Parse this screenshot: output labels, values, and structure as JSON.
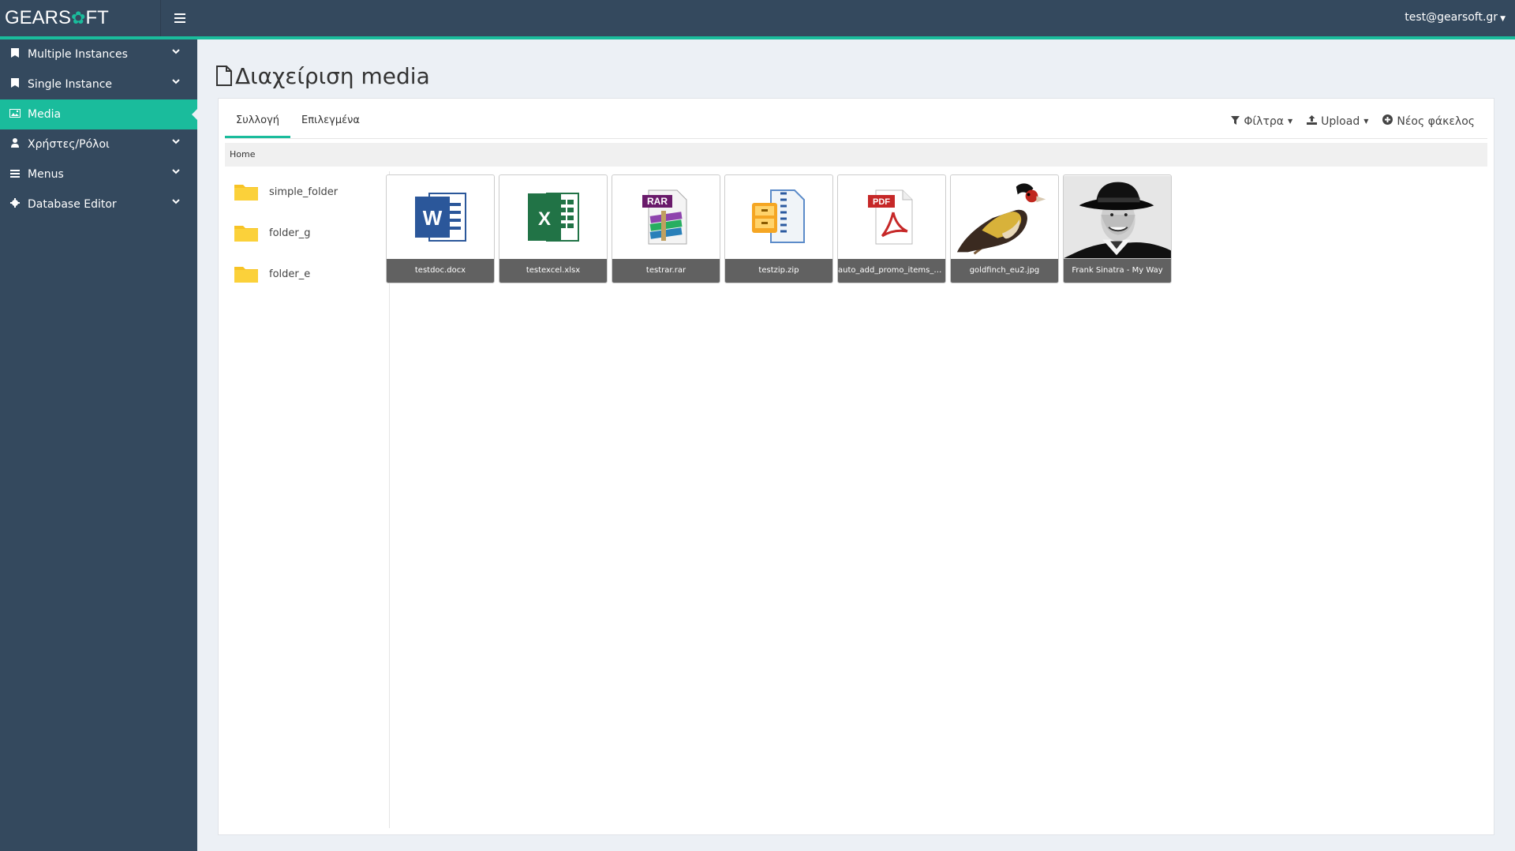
{
  "header": {
    "logo_left": "GEARS",
    "logo_right": "FT",
    "user": "test@gearsoft.gr"
  },
  "sidebar": {
    "items": [
      {
        "label": "Multiple Instances",
        "icon": "bookmark-icon"
      },
      {
        "label": "Single Instance",
        "icon": "bookmark-icon"
      },
      {
        "label": "Media",
        "icon": "image-icon"
      },
      {
        "label": "Χρήστες/Ρόλοι",
        "icon": "user-icon"
      },
      {
        "label": "Menus",
        "icon": "list-icon"
      },
      {
        "label": "Database Editor",
        "icon": "gear-icon"
      }
    ]
  },
  "page": {
    "title": "Διαχείριση media"
  },
  "tabs": [
    "Συλλογή",
    "Επιλεγμένα"
  ],
  "toolbar": {
    "filters": "Φίλτρα",
    "upload": "Upload",
    "new_folder": "Νέος φάκελος"
  },
  "breadcrumb": "Home",
  "folders": [
    "simple_folder",
    "folder_g",
    "folder_e"
  ],
  "files": [
    {
      "name": "testdoc.docx",
      "type": "word-icon"
    },
    {
      "name": "testexcel.xlsx",
      "type": "excel-icon"
    },
    {
      "name": "testrar.rar",
      "type": "rar-icon"
    },
    {
      "name": "testzip.zip",
      "type": "zip-icon"
    },
    {
      "name": "auto_add_promo_items_u...",
      "type": "pdf-icon"
    },
    {
      "name": "goldfinch_eu2.jpg",
      "type": "bird-image"
    },
    {
      "name": "Frank Sinatra - My Way",
      "type": "portrait-image"
    }
  ],
  "colors": {
    "topbar": "#34495e",
    "accent": "#1abc9c",
    "sidebar": "#34495e"
  }
}
